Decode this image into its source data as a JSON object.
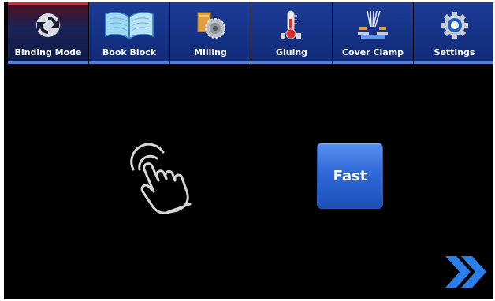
{
  "tabs": [
    {
      "label": "Binding Mode",
      "icon": "binding-mode-cycle-icon",
      "active": true
    },
    {
      "label": "Book Block",
      "icon": "open-book-icon",
      "active": false
    },
    {
      "label": "Milling",
      "icon": "milling-saw-icon",
      "active": false
    },
    {
      "label": "Gluing",
      "icon": "thermometer-icon",
      "active": false
    },
    {
      "label": "Cover Clamp",
      "icon": "cover-clamp-icon",
      "active": false
    },
    {
      "label": "Settings",
      "icon": "gear-icon",
      "active": false
    }
  ],
  "main": {
    "gesture_icon": "touch-hand-icon",
    "speed_button_label": "Fast",
    "next_icon": "double-chevron-right-icon"
  },
  "colors": {
    "tab_blue": "#17348a",
    "active_accent": "#e0243a",
    "button_blue": "#2f6ad8",
    "background": "#000000"
  }
}
